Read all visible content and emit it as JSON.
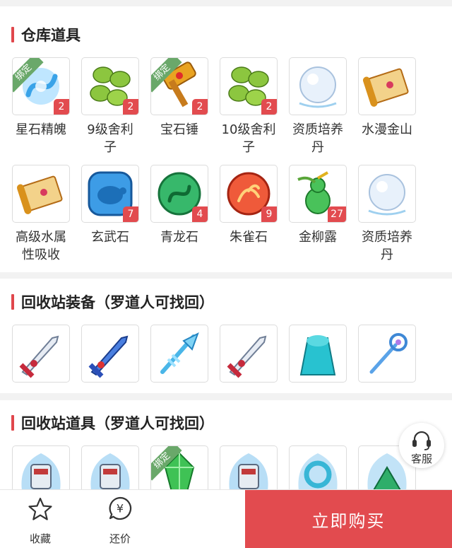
{
  "sections": [
    {
      "title": "仓库道具",
      "items": [
        {
          "name": "星石精魄",
          "count": "2",
          "bound": true,
          "icon": "blue-crystal-spirit-icon"
        },
        {
          "name": "9级舍利子",
          "count": "2",
          "bound": false,
          "icon": "green-sarira-icon"
        },
        {
          "name": "宝石锤",
          "count": "2",
          "bound": true,
          "icon": "gem-hammer-icon"
        },
        {
          "name": "10级舍利子",
          "count": "2",
          "bound": false,
          "icon": "green-sarira-icon"
        },
        {
          "name": "资质培养丹",
          "count": "",
          "bound": false,
          "icon": "white-pill-icon"
        },
        {
          "name": "水漫金山",
          "count": "",
          "bound": false,
          "icon": "scroll-icon"
        },
        {
          "name": "高级水属性吸收",
          "count": "",
          "bound": false,
          "icon": "scroll-icon"
        },
        {
          "name": "玄武石",
          "count": "7",
          "bound": false,
          "icon": "blue-turtle-stone-icon"
        },
        {
          "name": "青龙石",
          "count": "4",
          "bound": false,
          "icon": "green-dragon-stone-icon"
        },
        {
          "name": "朱雀石",
          "count": "9",
          "bound": false,
          "icon": "red-phoenix-stone-icon"
        },
        {
          "name": "金柳露",
          "count": "27",
          "bound": false,
          "icon": "green-gourd-icon"
        },
        {
          "name": "资质培养丹",
          "count": "",
          "bound": false,
          "icon": "white-pill-icon"
        }
      ]
    },
    {
      "title": "回收站装备（罗道人可找回）",
      "items": [
        {
          "name": "",
          "count": "",
          "bound": false,
          "icon": "red-sword-icon"
        },
        {
          "name": "",
          "count": "",
          "bound": false,
          "icon": "blue-sword-icon"
        },
        {
          "name": "",
          "count": "",
          "bound": false,
          "icon": "ice-spear-icon"
        },
        {
          "name": "",
          "count": "",
          "bound": false,
          "icon": "red-sword-icon"
        },
        {
          "name": "",
          "count": "",
          "bound": false,
          "icon": "cyan-cloak-icon"
        },
        {
          "name": "",
          "count": "",
          "bound": false,
          "icon": "blue-staff-icon"
        }
      ]
    },
    {
      "title": "回收站道具（罗道人可找回）",
      "items": [
        {
          "name": "",
          "count": "",
          "bound": false,
          "icon": "armor-icon"
        },
        {
          "name": "",
          "count": "",
          "bound": false,
          "icon": "armor-icon"
        },
        {
          "name": "",
          "count": "",
          "bound": true,
          "icon": "green-crystal-icon"
        },
        {
          "name": "",
          "count": "",
          "bound": false,
          "icon": "armor-icon"
        },
        {
          "name": "",
          "count": "",
          "bound": false,
          "icon": "jade-ring-icon"
        },
        {
          "name": "",
          "count": "",
          "bound": false,
          "icon": "green-fan-icon"
        }
      ]
    }
  ],
  "bound_tag": "绑定",
  "service_label": "客服",
  "bottom_bar": {
    "favorite_label": "收藏",
    "bargain_label": "还价",
    "bargain_symbol": "¥",
    "buy_label": "立即购买"
  },
  "colors": {
    "accent": "#e24b4f",
    "bound_tag": "#6aa86a"
  }
}
